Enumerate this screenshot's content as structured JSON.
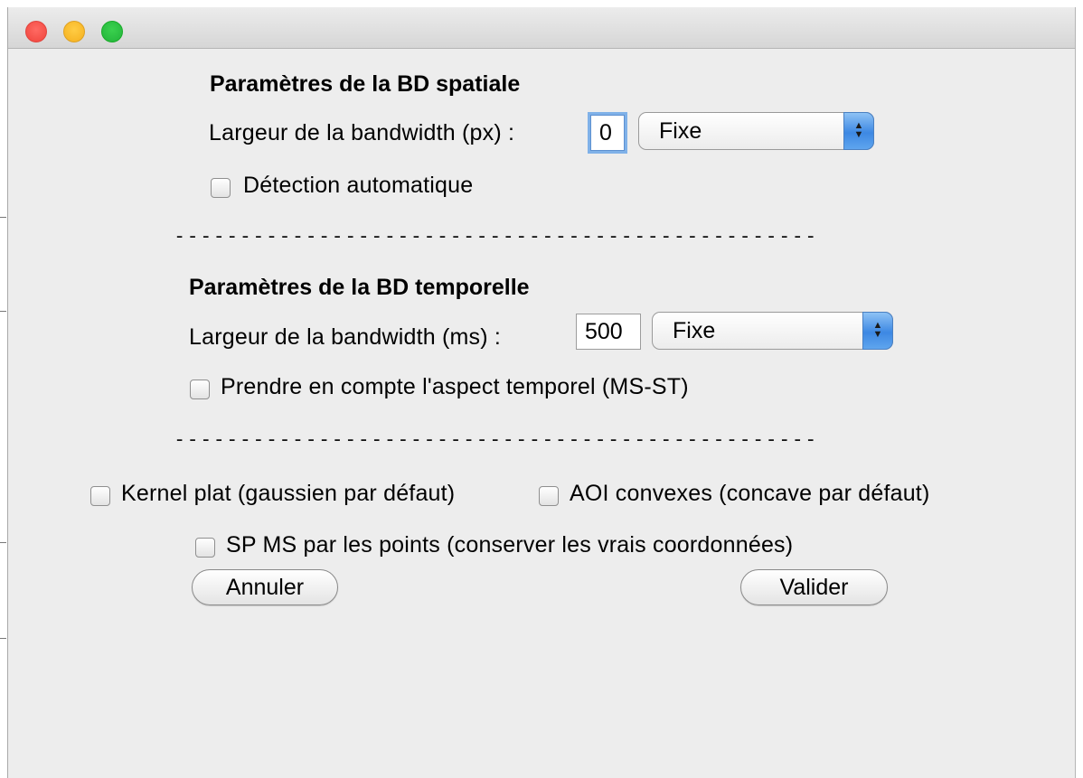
{
  "window": {
    "controls": [
      "close",
      "minimize",
      "zoom"
    ]
  },
  "spatial": {
    "heading": "Paramètres de la BD spatiale",
    "width_label": "Largeur de la bandwidth (px) :",
    "width_value": "0",
    "mode_value": "Fixe",
    "auto_label": "Détection automatique",
    "auto_checked": false
  },
  "separator_text": "-------------------------------------------------",
  "temporal": {
    "heading": "Paramètres de la BD temporelle",
    "width_label": "Largeur de la bandwidth (ms) :",
    "width_value": "500",
    "mode_value": "Fixe",
    "mst_label": "Prendre en compte l'aspect temporel (MS-ST)",
    "mst_checked": false
  },
  "options": {
    "kernel_label": "Kernel plat (gaussien par défaut)",
    "kernel_checked": false,
    "aoi_label": "AOI convexes (concave par défaut)",
    "aoi_checked": false,
    "sp_label": "SP MS par les points (conserver les vrais coordonnées)",
    "sp_checked": false
  },
  "buttons": {
    "cancel": "Annuler",
    "ok": "Valider"
  }
}
